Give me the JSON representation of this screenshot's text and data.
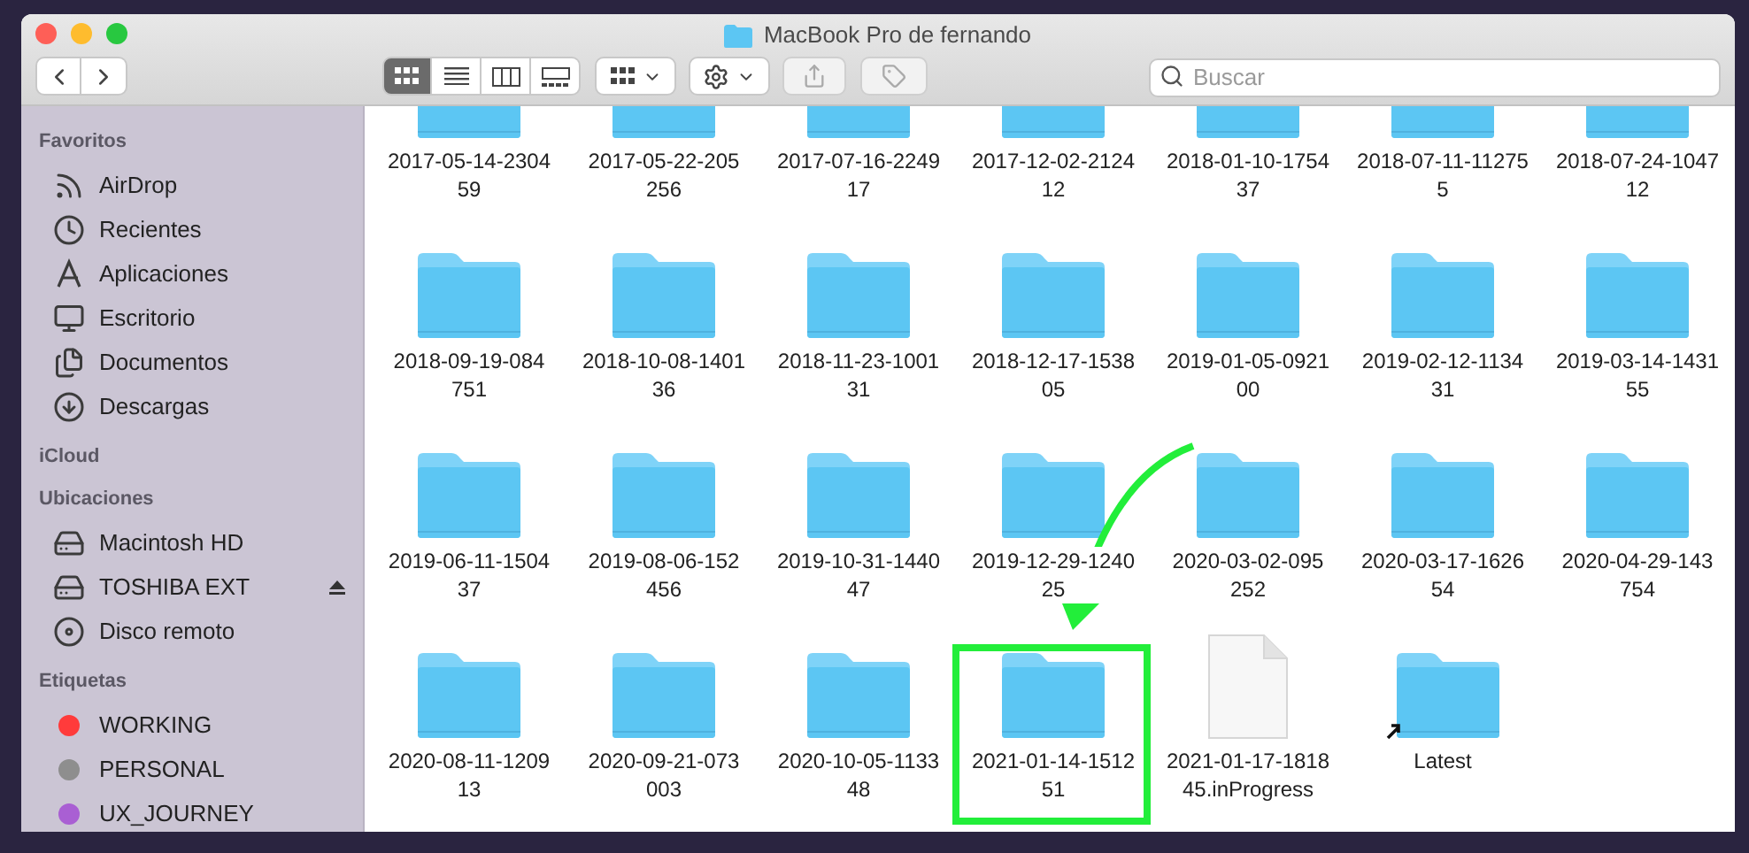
{
  "window": {
    "title": "MacBook Pro de fernando"
  },
  "toolbar": {
    "view_modes": [
      {
        "kind": "icons",
        "selected": true
      },
      {
        "kind": "list",
        "selected": false
      },
      {
        "kind": "columns",
        "selected": false
      },
      {
        "kind": "gallery",
        "selected": false
      }
    ],
    "search": {
      "placeholder": "Buscar"
    }
  },
  "sidebar": [
    {
      "heading": "Favoritos",
      "items": [
        {
          "label": "AirDrop",
          "kind": "airdrop"
        },
        {
          "label": "Recientes",
          "kind": "recents"
        },
        {
          "label": "Aplicaciones",
          "kind": "apps"
        },
        {
          "label": "Escritorio",
          "kind": "desktop"
        },
        {
          "label": "Documentos",
          "kind": "documents"
        },
        {
          "label": "Descargas",
          "kind": "downloads"
        }
      ]
    },
    {
      "heading": "iCloud"
    },
    {
      "heading": "Ubicaciones",
      "items": [
        {
          "label": "Macintosh HD",
          "kind": "disk"
        },
        {
          "label": "TOSHIBA EXT",
          "kind": "external",
          "ejectable": true
        },
        {
          "label": "Disco remoto",
          "kind": "optical"
        }
      ]
    },
    {
      "heading": "Etiquetas",
      "items": [
        {
          "label": "WORKING",
          "kind": "tag",
          "color": "#ff3b3b"
        },
        {
          "label": "PERSONAL",
          "kind": "tag",
          "color": "#8e8e8e"
        },
        {
          "label": "UX_JOURNEY",
          "kind": "tag",
          "color": "#a95fd3"
        }
      ]
    }
  ],
  "files": [
    {
      "lines": [
        "2017-05-14-2304",
        "59"
      ],
      "kind": "folder",
      "highlighted": false
    },
    {
      "lines": [
        "2017-05-22-205",
        "256"
      ],
      "kind": "folder",
      "highlighted": false
    },
    {
      "lines": [
        "2017-07-16-2249",
        "17"
      ],
      "kind": "folder",
      "highlighted": false
    },
    {
      "lines": [
        "2017-12-02-2124",
        "12"
      ],
      "kind": "folder",
      "highlighted": false
    },
    {
      "lines": [
        "2018-01-10-1754",
        "37"
      ],
      "kind": "folder",
      "highlighted": false
    },
    {
      "lines": [
        "2018-07-11-11275",
        "5"
      ],
      "kind": "folder",
      "highlighted": false
    },
    {
      "lines": [
        "2018-07-24-1047",
        "12"
      ],
      "kind": "folder",
      "highlighted": false
    },
    {
      "lines": [
        "2018-09-19-084",
        "751"
      ],
      "kind": "folder",
      "highlighted": false
    },
    {
      "lines": [
        "2018-10-08-1401",
        "36"
      ],
      "kind": "folder",
      "highlighted": false
    },
    {
      "lines": [
        "2018-11-23-1001",
        "31"
      ],
      "kind": "folder",
      "highlighted": false
    },
    {
      "lines": [
        "2018-12-17-1538",
        "05"
      ],
      "kind": "folder",
      "highlighted": false
    },
    {
      "lines": [
        "2019-01-05-0921",
        "00"
      ],
      "kind": "folder",
      "highlighted": false
    },
    {
      "lines": [
        "2019-02-12-1134",
        "31"
      ],
      "kind": "folder",
      "highlighted": false
    },
    {
      "lines": [
        "2019-03-14-1431",
        "55"
      ],
      "kind": "folder",
      "highlighted": false
    },
    {
      "lines": [
        "2019-06-11-1504",
        "37"
      ],
      "kind": "folder",
      "highlighted": false
    },
    {
      "lines": [
        "2019-08-06-152",
        "456"
      ],
      "kind": "folder",
      "highlighted": false
    },
    {
      "lines": [
        "2019-10-31-1440",
        "47"
      ],
      "kind": "folder",
      "highlighted": false
    },
    {
      "lines": [
        "2019-12-29-1240",
        "25"
      ],
      "kind": "folder",
      "highlighted": false
    },
    {
      "lines": [
        "2020-03-02-095",
        "252"
      ],
      "kind": "folder",
      "highlighted": false
    },
    {
      "lines": [
        "2020-03-17-1626",
        "54"
      ],
      "kind": "folder",
      "highlighted": false
    },
    {
      "lines": [
        "2020-04-29-143",
        "754"
      ],
      "kind": "folder",
      "highlighted": false
    },
    {
      "lines": [
        "2020-08-11-1209",
        "13"
      ],
      "kind": "folder",
      "highlighted": false
    },
    {
      "lines": [
        "2020-09-21-073",
        "003"
      ],
      "kind": "folder",
      "highlighted": false
    },
    {
      "lines": [
        "2020-10-05-1133",
        "48"
      ],
      "kind": "folder",
      "highlighted": false
    },
    {
      "lines": [
        "2021-01-14-1512",
        "51"
      ],
      "kind": "folder",
      "highlighted": true
    },
    {
      "lines": [
        "2021-01-17-1818",
        "45.inProgress"
      ],
      "kind": "file",
      "highlighted": false
    },
    {
      "lines": [
        "Latest"
      ],
      "kind": "alias",
      "highlighted": false
    }
  ]
}
